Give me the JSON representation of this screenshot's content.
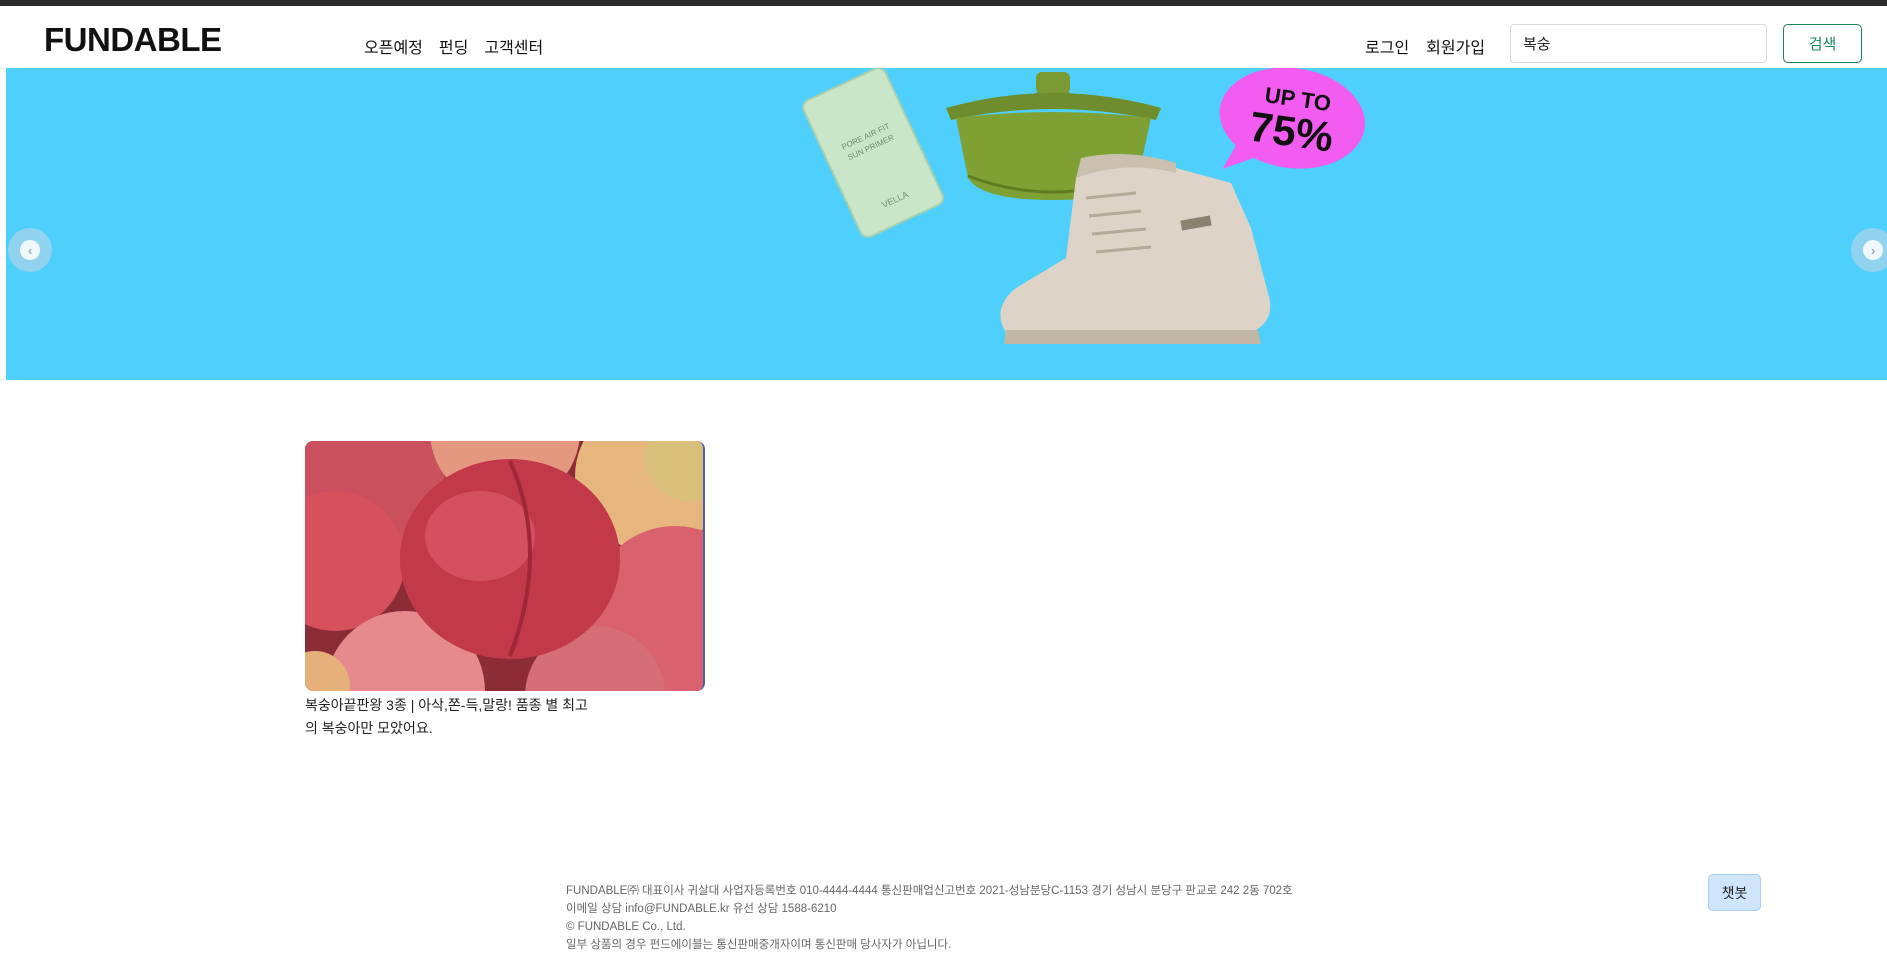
{
  "header": {
    "logo_text": "FUNDABLE",
    "nav": [
      "오픈예정",
      "펀딩",
      "고객센터"
    ],
    "auth": {
      "login": "로그인",
      "signup": "회원가입"
    },
    "search": {
      "value": "복숭",
      "button": "검색"
    }
  },
  "banner": {
    "promo_line1": "UP TO",
    "promo_line2": "75%",
    "bottle_text": [
      "PORE AIR FIT",
      "SUN PRIMER",
      "VELLA"
    ],
    "prev_icon": "chevron-left-icon",
    "next_icon": "chevron-right-icon",
    "background_color": "#4fcffc"
  },
  "products": [
    {
      "title": "복숭아끝판왕 3종 | 아삭,쫀-득,말랑! 품종 별 최고의 복숭아만 모았어요."
    }
  ],
  "footer": {
    "lines": [
      "FUNDABLE㈜   대표이사 귀살대   사업자등록번호 010-4444-4444  통신판매업신고번호 2021-성남분당C-1153  경기 성남시 분당구 판교로 242 2동 702호",
      "이메일 상담 info@FUNDABLE.kr  유선 상담 1588-6210",
      "© FUNDABLE Co., Ltd.",
      "일부 상품의 경우 펀드에이블는 통신판매중개자이며 통신판매 당사자가 아닙니다."
    ]
  },
  "chatbot": {
    "label": "챗봇"
  },
  "colors": {
    "accent": "#198754",
    "banner": "#4fcffc",
    "promo": "#f25cf0"
  }
}
